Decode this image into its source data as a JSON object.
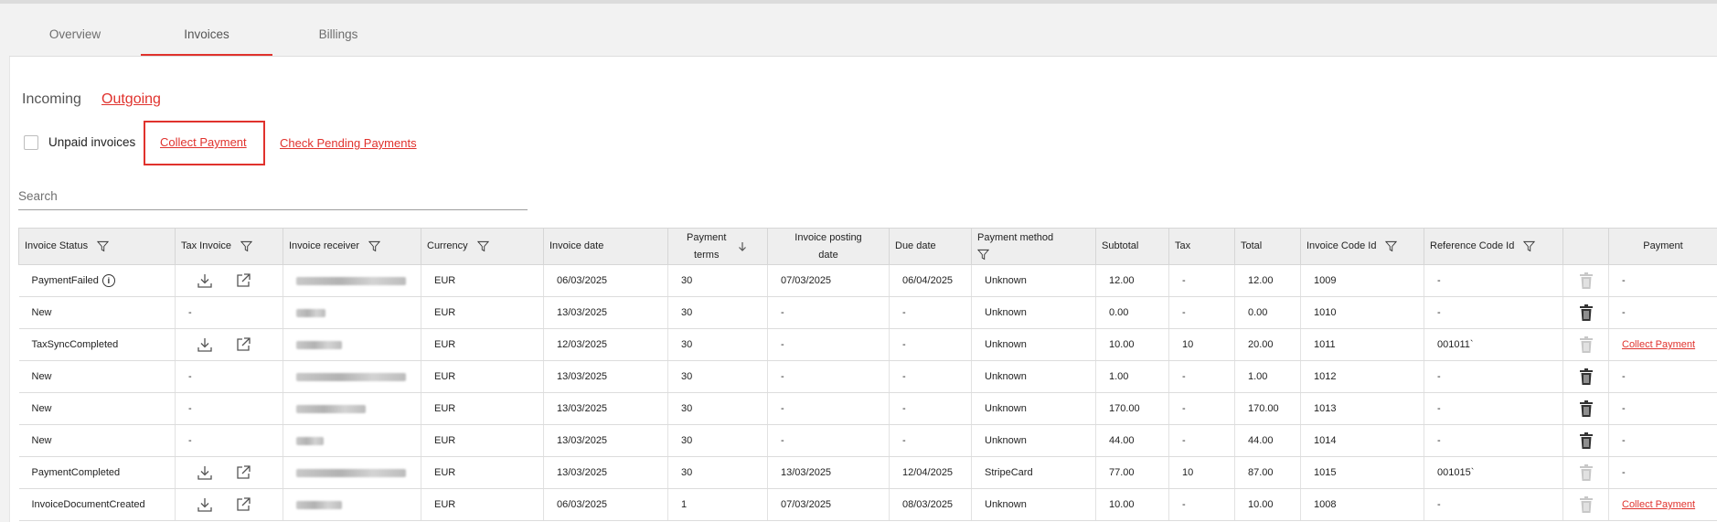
{
  "tabs": [
    {
      "label": "Overview",
      "active": false
    },
    {
      "label": "Invoices",
      "active": true
    },
    {
      "label": "Billings",
      "active": false
    }
  ],
  "subnav": {
    "incoming": "Incoming",
    "outgoing": "Outgoing"
  },
  "filters": {
    "unpaid_label": "Unpaid invoices",
    "collect_payment": "Collect Payment",
    "check_pending": "Check Pending Payments"
  },
  "search": {
    "placeholder": "Search",
    "value": ""
  },
  "colors": {
    "accent": "#e0322d",
    "header_bg": "#eeeeee"
  },
  "table": {
    "headers": {
      "status": "Invoice Status",
      "tax_invoice": "Tax Invoice",
      "receiver": "Invoice receiver",
      "currency": "Currency",
      "invoice_date": "Invoice date",
      "payment_terms_1": "Payment",
      "payment_terms_2": "terms",
      "posting_date_1": "Invoice posting",
      "posting_date_2": "date",
      "due_date": "Due date",
      "payment_method": "Payment method",
      "subtotal": "Subtotal",
      "tax": "Tax",
      "total": "Total",
      "code_id": "Invoice Code Id",
      "reference_id": "Reference Code Id",
      "payment": "Payment"
    },
    "rows": [
      {
        "status": "PaymentFailed",
        "info": "i",
        "tax_icons": true,
        "currency": "EUR",
        "invoice_date": "06/03/2025",
        "terms": "30",
        "posting": "07/03/2025",
        "due": "06/04/2025",
        "method": "Unknown",
        "subtotal": "12.00",
        "tax": "-",
        "total": "12.00",
        "code": "1009",
        "ref": "-",
        "payment": "-",
        "trash_active": false
      },
      {
        "status": "New",
        "tax_text": "-",
        "currency": "EUR",
        "invoice_date": "13/03/2025",
        "terms": "30",
        "posting": "-",
        "due": "-",
        "method": "Unknown",
        "subtotal": "0.00",
        "tax": "-",
        "total": "0.00",
        "code": "1010",
        "ref": "-",
        "payment": "-",
        "trash_active": true
      },
      {
        "status": "TaxSyncCompleted",
        "tax_icons": true,
        "currency": "EUR",
        "invoice_date": "12/03/2025",
        "terms": "30",
        "posting": "-",
        "due": "-",
        "method": "Unknown",
        "subtotal": "10.00",
        "tax": "10",
        "total": "20.00",
        "code": "1011",
        "ref": "001011`",
        "payment_link": "Collect Payment",
        "trash_active": false
      },
      {
        "status": "New",
        "tax_text": "-",
        "currency": "EUR",
        "invoice_date": "13/03/2025",
        "terms": "30",
        "posting": "-",
        "due": "-",
        "method": "Unknown",
        "subtotal": "1.00",
        "tax": "-",
        "total": "1.00",
        "code": "1012",
        "ref": "-",
        "payment": "-",
        "trash_active": true
      },
      {
        "status": "New",
        "tax_text": "-",
        "currency": "EUR",
        "invoice_date": "13/03/2025",
        "terms": "30",
        "posting": "-",
        "due": "-",
        "method": "Unknown",
        "subtotal": "170.00",
        "tax": "-",
        "total": "170.00",
        "code": "1013",
        "ref": "-",
        "payment": "-",
        "trash_active": true
      },
      {
        "status": "New",
        "tax_text": "-",
        "currency": "EUR",
        "invoice_date": "13/03/2025",
        "terms": "30",
        "posting": "-",
        "due": "-",
        "method": "Unknown",
        "subtotal": "44.00",
        "tax": "-",
        "total": "44.00",
        "code": "1014",
        "ref": "-",
        "payment": "-",
        "trash_active": true
      },
      {
        "status": "PaymentCompleted",
        "tax_icons": true,
        "currency": "EUR",
        "invoice_date": "13/03/2025",
        "terms": "30",
        "posting": "13/03/2025",
        "due": "12/04/2025",
        "method": "StripeCard",
        "subtotal": "77.00",
        "tax": "10",
        "total": "87.00",
        "code": "1015",
        "ref": "001015`",
        "payment": "-",
        "trash_active": false
      },
      {
        "status": "InvoiceDocumentCreated",
        "tax_icons": true,
        "currency": "EUR",
        "invoice_date": "06/03/2025",
        "terms": "1",
        "posting": "07/03/2025",
        "due": "08/03/2025",
        "method": "Unknown",
        "subtotal": "10.00",
        "tax": "-",
        "total": "10.00",
        "code": "1008",
        "ref": "-",
        "payment_link": "Collect Payment",
        "trash_active": false
      }
    ]
  }
}
